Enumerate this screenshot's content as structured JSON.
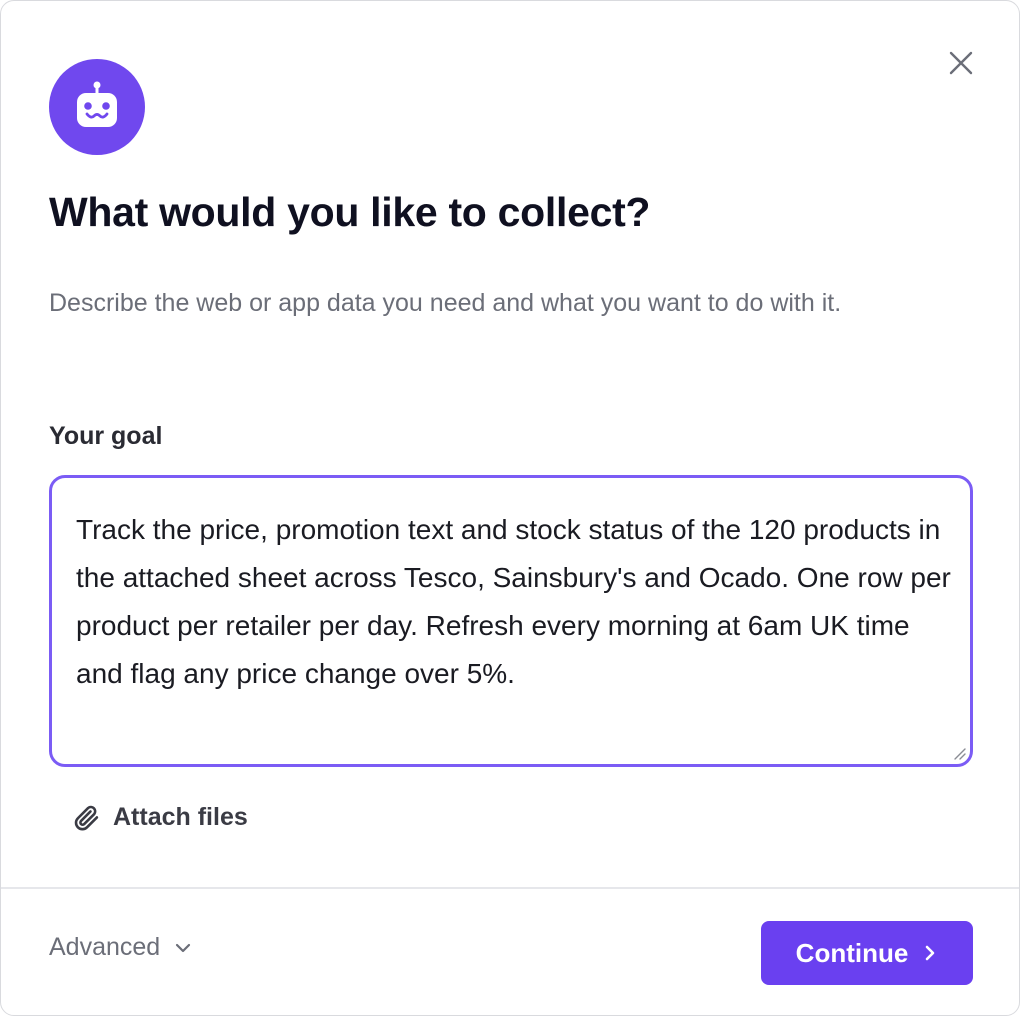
{
  "dialog": {
    "title": "What would you like to collect?",
    "subtitle": "Describe the web or app data you need and what you want to do with it.",
    "goal_label": "Your goal",
    "goal_value": "Track the price, promotion text and stock status of the 120 products in the attached sheet across Tesco, Sainsbury's and Ocado. One row per product per retailer per day. Refresh every morning at 6am UK time and flag any price change over 5%.",
    "attach_label": "Attach files",
    "advanced_label": "Advanced",
    "continue_label": "Continue"
  },
  "icons": {
    "avatar": "robot-icon",
    "close": "close-icon",
    "attach": "paperclip-icon",
    "advanced": "chevron-down-icon",
    "continue": "chevron-right-icon"
  },
  "colors": {
    "accent": "#6a40f0",
    "avatar_bg": "#7048ee",
    "focus_border": "#7b5cf5"
  }
}
